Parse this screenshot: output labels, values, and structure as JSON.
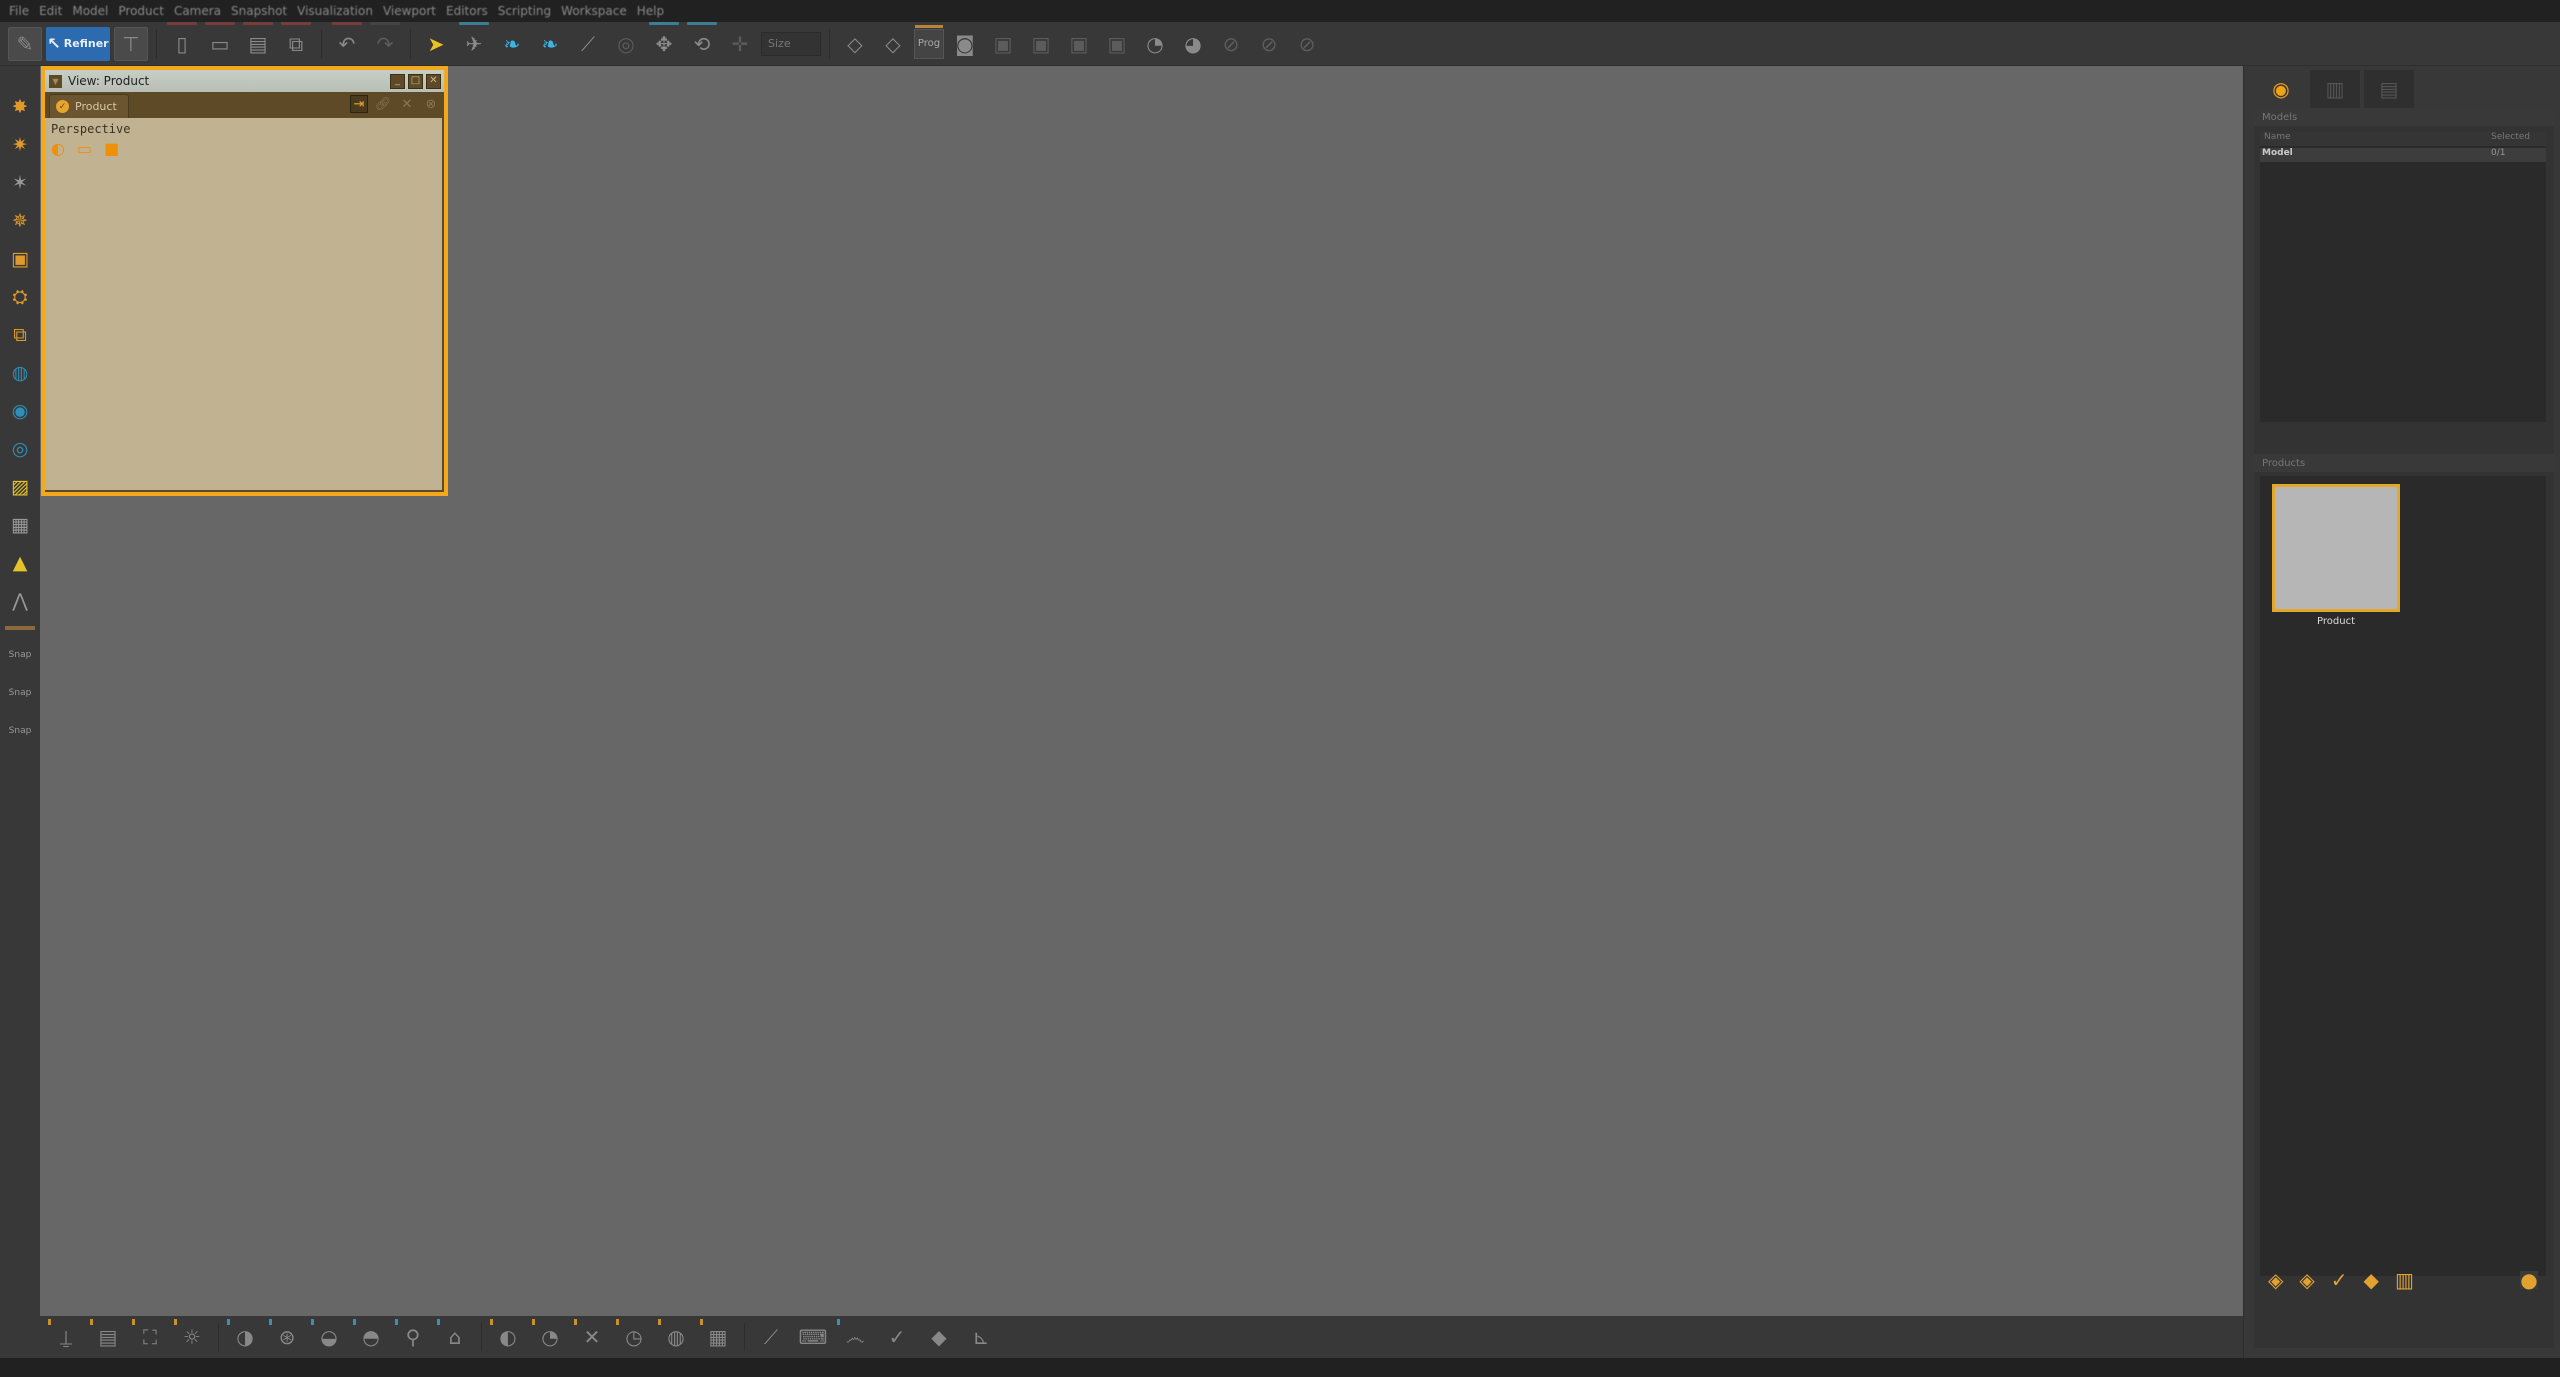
{
  "menubar": {
    "items": [
      "File",
      "Edit",
      "Model",
      "Product",
      "Camera",
      "Snapshot",
      "Visualization",
      "Viewport",
      "Editors",
      "Scripting",
      "Workspace",
      "Help"
    ]
  },
  "toolbar": {
    "mode_label": "Refiner",
    "size_input_placeholder": "Size",
    "prog_label": "Prog"
  },
  "view_window": {
    "title": "View: Product",
    "tab_label": "Product",
    "camera_mode": "Perspective",
    "minimize_glyph": "_",
    "maximize_glyph": "□",
    "close_glyph": "✕"
  },
  "right_dock": {
    "models_title": "Models",
    "models_columns": [
      "Name",
      "Selected"
    ],
    "models_rows": [
      {
        "name": "Model",
        "selected": "0/1"
      }
    ],
    "products_title": "Products",
    "products": [
      {
        "label": "Product"
      }
    ]
  },
  "colors": {
    "accent": "#f4a81c",
    "view_bg": "#c1b291",
    "viewport_bg": "#676767",
    "mode_blue": "#2d6bb0"
  }
}
